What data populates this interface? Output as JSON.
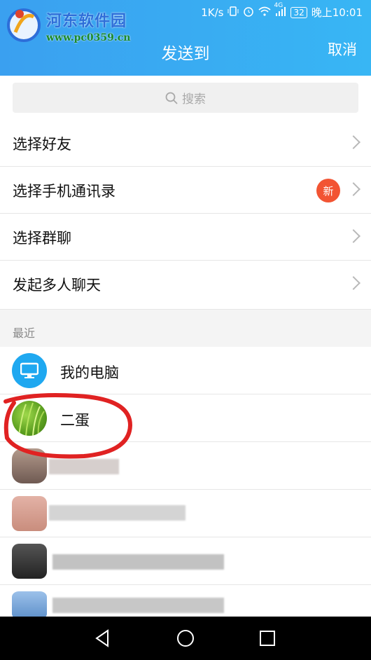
{
  "status": {
    "speed": "1K/s",
    "signal": "4G",
    "battery": "32",
    "time": "晚上10:01"
  },
  "watermark": {
    "name": "河东软件园",
    "url": "www.pc0359.cn"
  },
  "header": {
    "title": "发送到",
    "cancel_label": "取消"
  },
  "search": {
    "placeholder": "搜索"
  },
  "menu": [
    {
      "label": "选择好友"
    },
    {
      "label": "选择手机通讯录",
      "badge": "新"
    },
    {
      "label": "选择群聊"
    },
    {
      "label": "发起多人聊天"
    }
  ],
  "recent": {
    "label": "最近",
    "contacts": [
      {
        "name": "我的电脑"
      },
      {
        "name": "二蛋"
      }
    ]
  },
  "colors": {
    "header_blue": "#38b6f4",
    "badge_red": "#f25433",
    "highlight_red": "#e02222"
  }
}
